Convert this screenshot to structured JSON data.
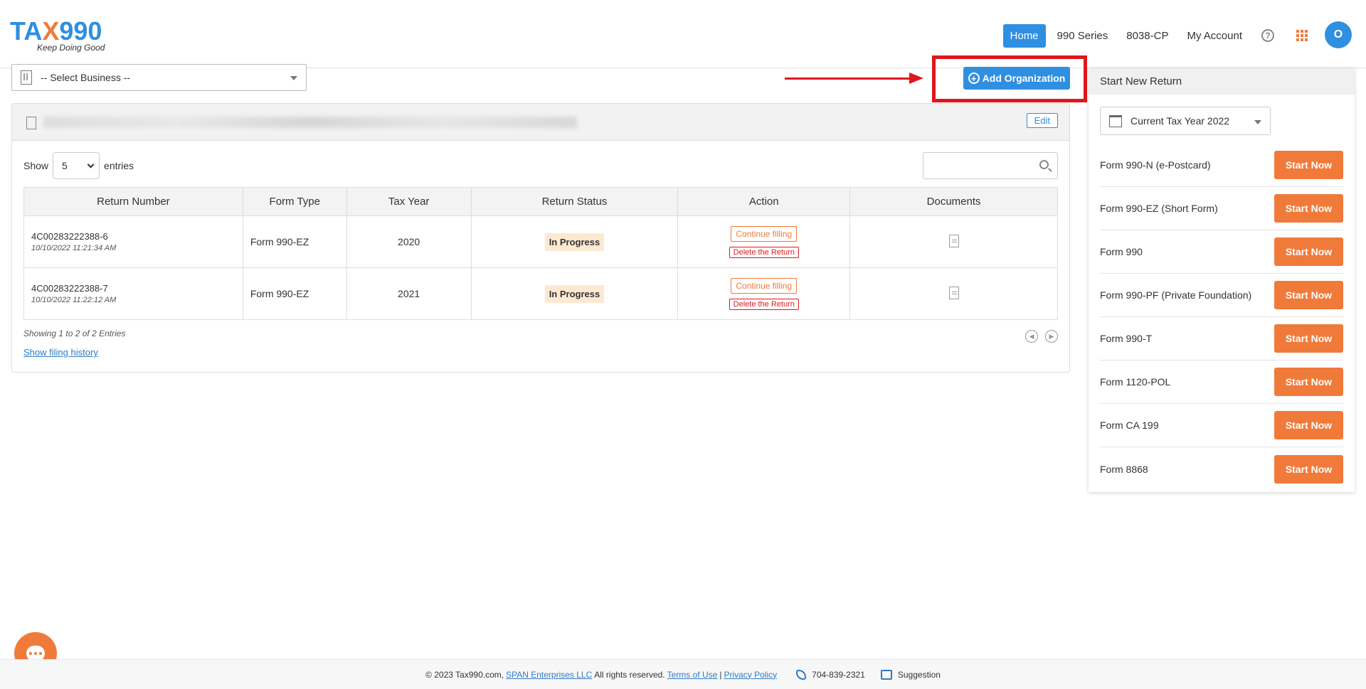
{
  "header": {
    "logo_main_prefix": "TA",
    "logo_main_x": "X",
    "logo_main_suffix": "990",
    "logo_tagline": "Keep Doing Good",
    "nav": [
      "Home",
      "990 Series",
      "8038-CP",
      "My Account"
    ],
    "avatar_initial": "O"
  },
  "business_select": {
    "value": "-- Select Business --"
  },
  "add_org_label": "Add Organization",
  "panel": {
    "edit_label": "Edit",
    "show_label": "Show",
    "entries_value": "5",
    "entries_label": "entries",
    "columns": [
      "Return Number",
      "Form Type",
      "Tax Year",
      "Return Status",
      "Action",
      "Documents"
    ],
    "rows": [
      {
        "return_number": "4C00283222388-6",
        "date": "10/10/2022 11:21:34 AM",
        "form_type": "Form 990-EZ",
        "tax_year": "2020",
        "status": "In Progress",
        "continue": "Continue filling",
        "delete": "Delete the Return"
      },
      {
        "return_number": "4C00283222388-7",
        "date": "10/10/2022 11:22:12 AM",
        "form_type": "Form 990-EZ",
        "tax_year": "2021",
        "status": "In Progress",
        "continue": "Continue filling",
        "delete": "Delete the Return"
      }
    ],
    "showing_text": "Showing 1 to 2 of 2 Entries",
    "history_link": "Show filing history"
  },
  "sidebar": {
    "title": "Start New Return",
    "year_select": "Current Tax Year 2022",
    "start_label": "Start Now",
    "forms": [
      {
        "name": "Form 990-N (e-Postcard)"
      },
      {
        "name": "Form 990-EZ (Short Form)"
      },
      {
        "name": "Form 990"
      },
      {
        "name": "Form 990-PF (Private Foundation)"
      },
      {
        "name": "Form 990-T"
      },
      {
        "name": "Form 1120-POL"
      },
      {
        "name": "Form CA 199"
      },
      {
        "name": "Form 8868"
      }
    ]
  },
  "footer": {
    "copyright": "© 2023 Tax990.com,",
    "company_link": "SPAN Enterprises LLC",
    "rights": "All rights reserved.",
    "terms": "Terms of Use",
    "separator": "|",
    "privacy": "Privacy Policy",
    "phone": "704-839-2321",
    "suggestion": "Suggestion"
  },
  "colors": {
    "primary_blue": "#2f8fe0",
    "accent_orange": "#f07a3a",
    "annotation_red": "#e0161c"
  }
}
